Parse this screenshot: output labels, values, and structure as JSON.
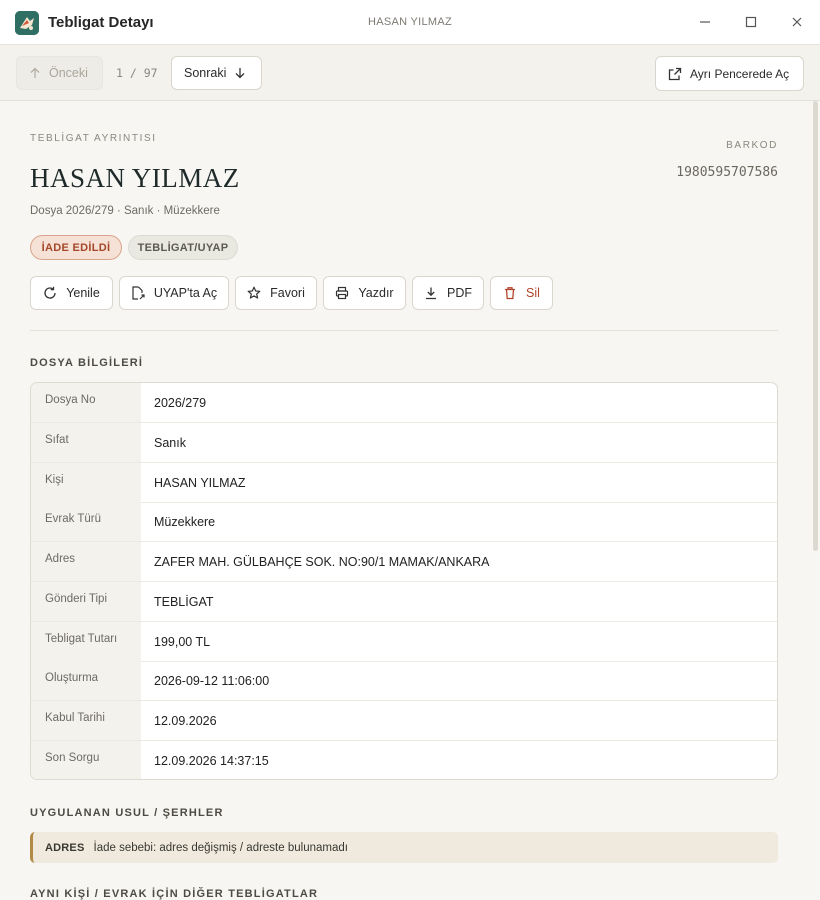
{
  "window": {
    "app_title": "Tebligat Detayı",
    "center_title": "HASAN YILMAZ",
    "controls": [
      "minimize",
      "maximize",
      "close"
    ]
  },
  "toolbar": {
    "prev_label": "Önceki",
    "counter_current": "1",
    "counter_sep": "/",
    "counter_total": "97",
    "next_label": "Sonraki",
    "external_label": "Ayrı Pencerede Aç"
  },
  "detail": {
    "eyebrow": "TEBLİGAT AYRINTISI",
    "name": "HASAN YILMAZ",
    "meta": "Dosya 2026/279 · Sanık · Müzekkere",
    "barcode_label": "BARKOD",
    "barcode_value": "1980595707586",
    "badges": [
      {
        "label": "İADE EDİLDİ",
        "icon": "none"
      },
      {
        "label": "TEBLİGAT/UYAP",
        "icon": "none"
      }
    ]
  },
  "actions": [
    {
      "label": "Yenile",
      "icon": "refresh-icon"
    },
    {
      "label": "UYAP'ta Aç",
      "icon": "open-doc-icon"
    },
    {
      "label": "Favori",
      "icon": "star-icon"
    },
    {
      "label": "Yazdır",
      "icon": "printer-icon"
    },
    {
      "label": "PDF",
      "icon": "download-icon"
    },
    {
      "label": "Sil",
      "icon": "trash-icon"
    }
  ],
  "file_info": {
    "title": "DOSYA BİLGİLERİ",
    "rows": [
      {
        "label": "Dosya No",
        "value": "2026/279"
      },
      {
        "label": "Sıfat",
        "value": "Sanık"
      },
      {
        "label": "Kişi",
        "value": "HASAN YILMAZ"
      },
      {
        "label": "Evrak Türü",
        "value": "Müzekkere"
      },
      {
        "label": "Adres",
        "value": "ZAFER MAH. GÜLBAHÇE SOK. NO:90/1 MAMAK/ANKARA"
      },
      {
        "label": "Gönderi Tipi",
        "value": "TEBLİGAT"
      },
      {
        "label": "Tebligat Tutarı",
        "value": "199,00 TL"
      },
      {
        "label": "Oluşturma",
        "value": "2026-09-12 11:06:00"
      },
      {
        "label": "Kabul Tarihi",
        "value": "12.09.2026"
      },
      {
        "label": "Son Sorgu",
        "value": "12.09.2026 14:37:15"
      }
    ]
  },
  "procedure": {
    "title": "UYGULANAN USUL / ŞERHLER",
    "note_tag": "ADRES",
    "note_text": "İade sebebi: adres değişmiş / adreste bulunamadı"
  },
  "related": {
    "title": "AYNI KİŞİ / EVRAK İÇİN DİĞER TEBLİGATLAR"
  },
  "colors": {
    "accent_teal": "#2f6f63",
    "return_badge": "#a4472a",
    "note_border": "#b38a45"
  }
}
